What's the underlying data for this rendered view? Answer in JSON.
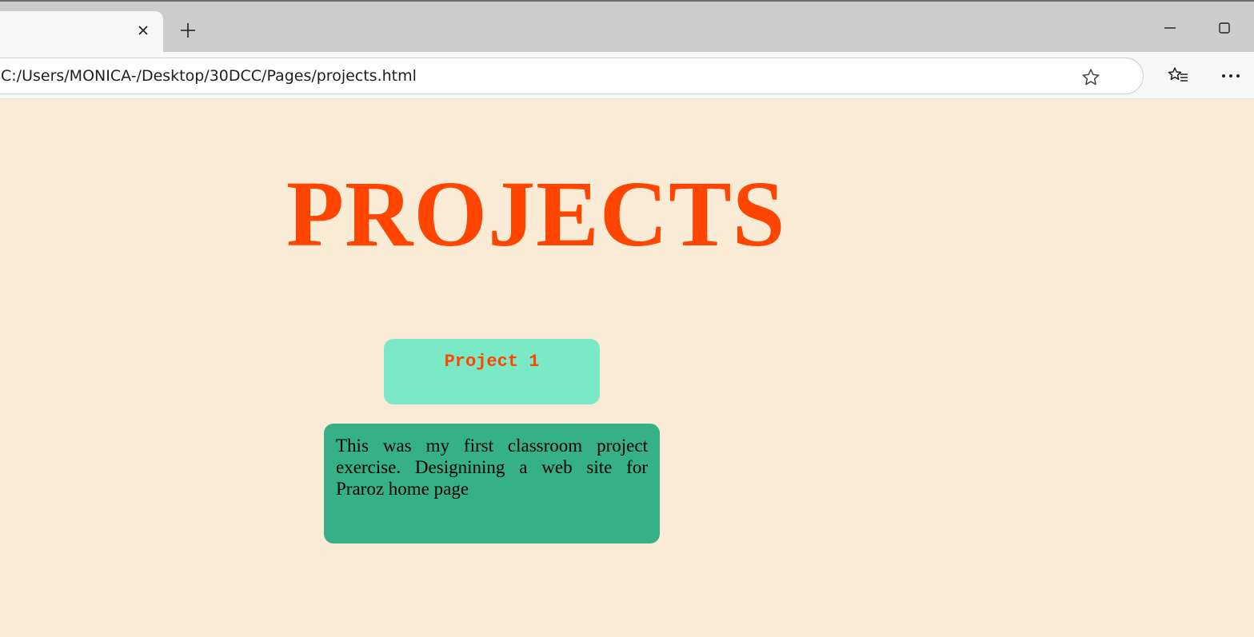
{
  "browser": {
    "address": "C:/Users/MONICA-/Desktop/30DCC/Pages/projects.html",
    "icons": {
      "tab_close": "close-icon",
      "new_tab": "plus-icon",
      "minimize": "minimize-icon",
      "maximize": "maximize-icon",
      "favorite": "star-icon",
      "favorites": "favorites-icon",
      "more": "more-icon"
    }
  },
  "page": {
    "title": "PROJECTS",
    "projects": [
      {
        "name": "Project 1",
        "description": "This was my first classroom project exercise. Designining a web site for Praroz home page"
      }
    ]
  },
  "colors": {
    "background": "#faebd7",
    "accent": "#ff4500",
    "card": "#7be8c6",
    "description_card": "#36b087"
  }
}
